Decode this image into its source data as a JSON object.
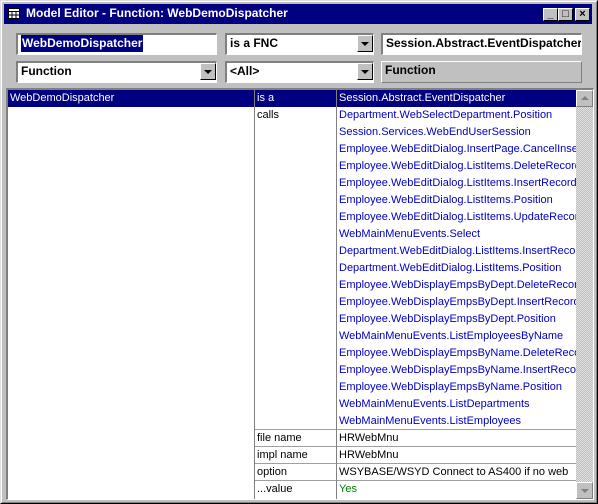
{
  "window": {
    "title": "Model Editor - Function: WebDemoDispatcher",
    "icon": "grid-window-icon",
    "controls": {
      "minimize": "_",
      "maximize": "□",
      "close": "×"
    }
  },
  "header": {
    "object_name": "WebDemoDispatcher",
    "verb": "is a FNC",
    "target_object": "Session.Abstract.EventDispatcher",
    "object_type": "Function",
    "filter": "<All>",
    "target_type": "Function"
  },
  "grid": {
    "subject": "WebDemoDispatcher",
    "rows": [
      {
        "verb": "is a",
        "value": "Session.Abstract.EventDispatcher",
        "style": "selected"
      },
      {
        "verb": "calls",
        "value": "Department.WebSelectDepartment.Position",
        "style": "link"
      },
      {
        "verb": "",
        "value": "Session.Services.WebEndUserSession",
        "style": "link"
      },
      {
        "verb": "",
        "value": "Employee.WebEditDialog.InsertPage.CancelInsert",
        "style": "link"
      },
      {
        "verb": "",
        "value": "Employee.WebEditDialog.ListItems.DeleteRecord",
        "style": "link"
      },
      {
        "verb": "",
        "value": "Employee.WebEditDialog.ListItems.InsertRecord",
        "style": "link"
      },
      {
        "verb": "",
        "value": "Employee.WebEditDialog.ListItems.Position",
        "style": "link"
      },
      {
        "verb": "",
        "value": "Employee.WebEditDialog.ListItems.UpdateRecord",
        "style": "link"
      },
      {
        "verb": "",
        "value": "WebMainMenuEvents.Select",
        "style": "link"
      },
      {
        "verb": "",
        "value": "Department.WebEditDialog.ListItems.InsertRecord",
        "style": "link"
      },
      {
        "verb": "",
        "value": "Department.WebEditDialog.ListItems.Position",
        "style": "link"
      },
      {
        "verb": "",
        "value": "Employee.WebDisplayEmpsByDept.DeleteRecord",
        "style": "link"
      },
      {
        "verb": "",
        "value": "Employee.WebDisplayEmpsByDept.InsertRecord",
        "style": "link"
      },
      {
        "verb": "",
        "value": "Employee.WebDisplayEmpsByDept.Position",
        "style": "link"
      },
      {
        "verb": "",
        "value": "WebMainMenuEvents.ListEmployeesByName",
        "style": "link"
      },
      {
        "verb": "",
        "value": "Employee.WebDisplayEmpsByName.DeleteRecord",
        "style": "link"
      },
      {
        "verb": "",
        "value": "Employee.WebDisplayEmpsByName.InsertRecord",
        "style": "link"
      },
      {
        "verb": "",
        "value": "Employee.WebDisplayEmpsByName.Position",
        "style": "link"
      },
      {
        "verb": "",
        "value": "WebMainMenuEvents.ListDepartments",
        "style": "link"
      },
      {
        "verb": "",
        "value": "WebMainMenuEvents.ListEmployees",
        "style": "link"
      },
      {
        "verb": "file name",
        "value": "HRWebMnu",
        "style": "plain"
      },
      {
        "verb": "impl name",
        "value": "HRWebMnu",
        "style": "plain"
      },
      {
        "verb": "option",
        "value": "WSYBASE/WSYD Connect to AS400 if no web",
        "style": "plain"
      },
      {
        "verb": "...value",
        "value": "Yes",
        "style": "green"
      }
    ]
  },
  "colors": {
    "titlebar": "#000080",
    "selection": "#000080",
    "link": "#0000c0",
    "value_green": "#008000"
  }
}
